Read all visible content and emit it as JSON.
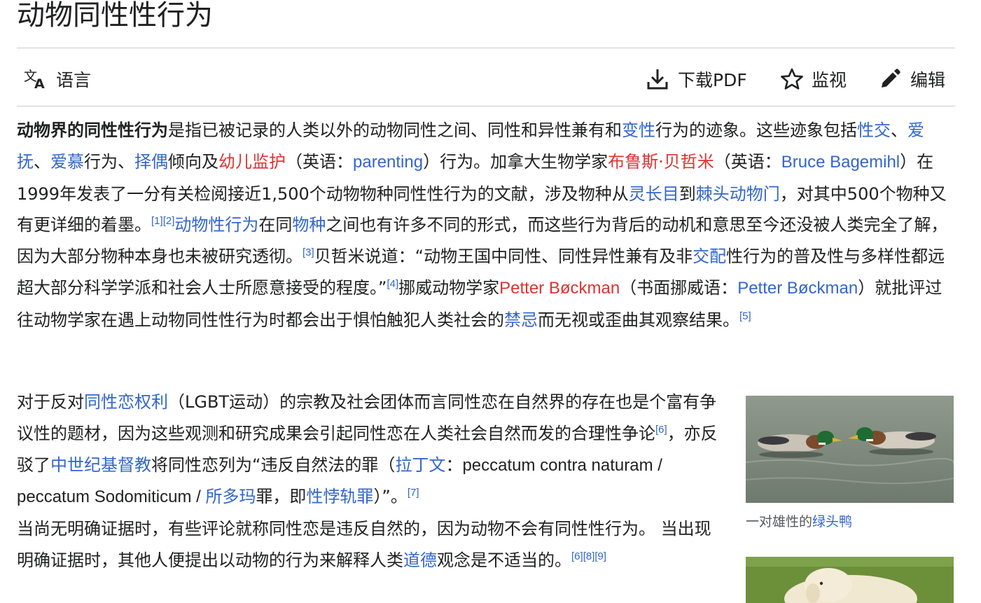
{
  "page": {
    "title": "动物同性性行为"
  },
  "toolbar": {
    "language": "语言",
    "download": "下载PDF",
    "watch": "监视",
    "edit": "编辑"
  },
  "lead": {
    "t01": "动物界的同性性行为",
    "t02": "是指已被记录的人类以外的动物同性之间、同性和异性兼有和",
    "t03": "变性",
    "t04": "行为的迹象。这些迹象包括",
    "t05": "性交",
    "t06": "、",
    "t07": "爱抚",
    "t08": "、",
    "t09": "爱慕",
    "t10": "行为、",
    "t11": "择偶",
    "t12": "倾向及",
    "t13": "幼儿监护",
    "t14": "（英语：",
    "t15": "parenting",
    "t16": "）行为。加拿大生物学家",
    "t17": "布鲁斯·贝哲米",
    "t18": "（英语：",
    "t19": "Bruce Bagemihl",
    "t20": "）在1999年发表了一分有关检阅接近1,500个动物物种同性性行为的文献，涉及物种从",
    "t21": "灵长目",
    "t22": "到",
    "t23": "棘头动物门",
    "t24": "，对其中500个物种又有更详细的着墨。",
    "r1": "[1]",
    "r2": "[2]",
    "t25": "动物性行为",
    "t26": "在同",
    "t27": "物种",
    "t28": "之间也有许多不同的形式，而这些行为背后的动机和意思至今还没被人类完全了解，因为大部分物种本身也未被研究透彻。",
    "r3": "[3]",
    "t29": "贝哲米说道：“动物王国中同性、同性异性兼有及非",
    "t30": "交配",
    "t31": "性行为的普及性与多样性都远超大部分科学学派和社会人士所愿意接受的程度。”",
    "r4": "[4]",
    "t32": "挪威动物学家",
    "t33": "Petter Bøckman",
    "t34": "（书面挪威语：",
    "t35": "Petter Bøckman",
    "t36": "）就批评过往动物学家在遇上动物同性性行为时都会出于惧怕触犯人类社会的",
    "t37": "禁忌",
    "t38": "而无视或歪曲其观察结果。",
    "r5": "[5]"
  },
  "para2": {
    "t01": "对于反对",
    "t02": "同性恋权利",
    "t03": "（LGBT运动）的宗教及社会团体而言同性恋在自然界的存在也是个富有争议性的题材，因为这些观测和研究成果会引起同性恋在人类社会自然而发的合理性争论",
    "r6": "[6]",
    "t04": "，亦反驳了",
    "t05": "中世纪基督教",
    "t06": "将同性恋列为“违反自然法的罪（",
    "t07": "拉丁文",
    "t08": "：",
    "t09": "peccatum contra naturam / peccatum Sodomiticum / ",
    "t10": "所多玛",
    "t11": "罪，即",
    "t12": "性悖轨罪",
    "t13": "）”。",
    "r7": "[7]",
    "t14": "当尚无明确证据时，有些评论就称同性恋是违反自然的，因为动物不会有同性性行为。 当出现明确证据时，其他人便提出以动物的行为来解释人类",
    "t15": "道德",
    "t16": "观念是不适当的。",
    "r8": "[6]",
    "r9": "[8]",
    "r10": "[9]"
  },
  "figure": {
    "caption_prefix": "一对雄性的",
    "caption_link": "绿头鸭"
  },
  "colors": {
    "link": "#3366cc",
    "redlink": "#dd3333",
    "text": "#202122",
    "rule": "#c8ccd1"
  },
  "icons": [
    "translate-icon",
    "download-icon",
    "star-icon",
    "pencil-icon"
  ]
}
